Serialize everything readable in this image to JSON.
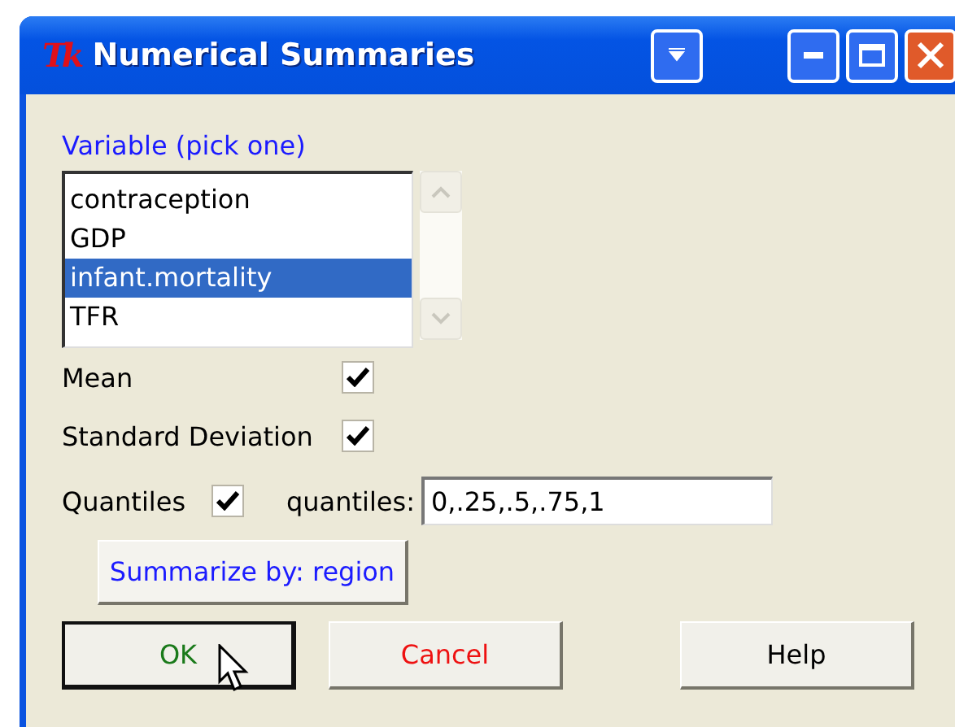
{
  "window": {
    "title": "Numerical Summaries",
    "logo": "Tk"
  },
  "variable_list": {
    "label": "Variable (pick one)",
    "items": [
      {
        "label": "contraception",
        "selected": false
      },
      {
        "label": "GDP",
        "selected": false
      },
      {
        "label": "infant.mortality",
        "selected": true
      },
      {
        "label": "TFR",
        "selected": false
      }
    ]
  },
  "options": [
    {
      "label": "Mean",
      "checked": true
    },
    {
      "label": "Standard Deviation",
      "checked": true
    }
  ],
  "quantiles": {
    "label": "Quantiles",
    "checked": true,
    "field_label": "quantiles:",
    "value": "0,.25,.5,.75,1"
  },
  "summarize_button": "Summarize by: region",
  "buttons": [
    {
      "label": "OK",
      "kind": "ok",
      "default": true
    },
    {
      "label": "Cancel",
      "kind": "cancel",
      "default": false
    },
    {
      "label": "Help",
      "kind": "help",
      "default": false
    }
  ]
}
